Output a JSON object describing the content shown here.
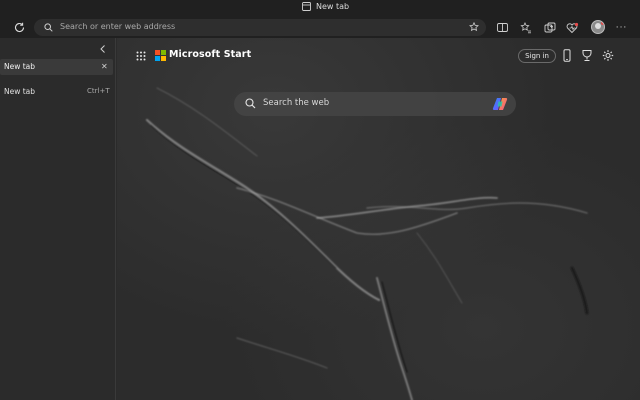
{
  "window": {
    "title": "New tab"
  },
  "toolbar": {
    "address_placeholder": "Search or enter web address",
    "icons": [
      "refresh-icon",
      "search-icon",
      "favorite-star-icon",
      "split-screen-icon",
      "favorites-icon",
      "collections-icon",
      "browser-essentials-icon",
      "profile-avatar",
      "more-icon"
    ]
  },
  "sidebar": {
    "active_tab": {
      "label": "New tab",
      "close": "✕"
    },
    "new_tab": {
      "label": "New tab",
      "shortcut": "Ctrl+T"
    }
  },
  "page": {
    "brand": "Microsoft Start",
    "sign_in": "Sign in",
    "search_placeholder": "Search the web",
    "logo_colors": [
      "#f25022",
      "#7fba00",
      "#00a4ef",
      "#ffb900"
    ]
  }
}
